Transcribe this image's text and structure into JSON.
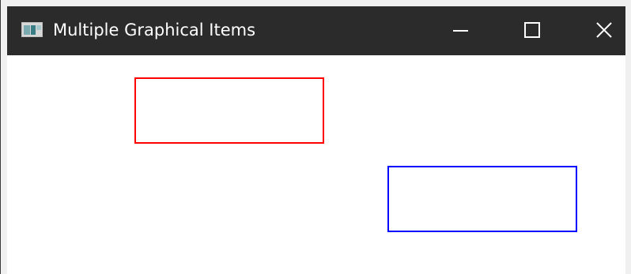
{
  "window": {
    "title": "Multiple Graphical Items"
  },
  "titlebar": {
    "app_icon": "window-app-icon",
    "minimize_icon": "minimize-icon",
    "maximize_icon": "maximize-icon",
    "close_icon": "close-icon"
  },
  "scene": {
    "items": [
      {
        "shape": "rectangle",
        "stroke_color": "#ff0000"
      },
      {
        "shape": "rectangle",
        "stroke_color": "#0000ff"
      }
    ]
  }
}
